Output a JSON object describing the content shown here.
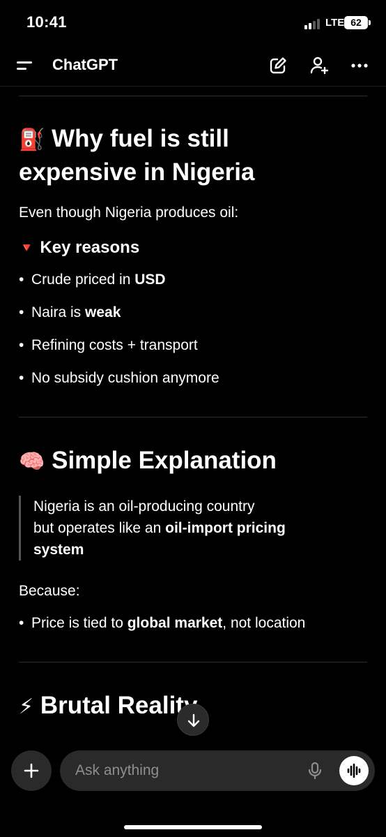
{
  "status_bar": {
    "time": "10:41",
    "network": "LTE",
    "battery": "62"
  },
  "header": {
    "title": "ChatGPT",
    "icons": [
      "menu-icon",
      "new-chat-icon",
      "add-person-icon",
      "more-icon"
    ]
  },
  "sections": [
    {
      "emoji": "⛽",
      "emoji_icon": "fuel-pump-icon",
      "heading_line1": "Why fuel is still",
      "heading_line2": "expensive in Nigeria",
      "intro": "Even though Nigeria produces oil:",
      "subheading_emoji": "🔻",
      "subheading": "Key reasons",
      "bullets": [
        {
          "text": "Crude priced in ",
          "bold": "USD"
        },
        {
          "text": "Naira is ",
          "bold": "weak"
        },
        {
          "text": "Refining costs + transport",
          "bold": ""
        },
        {
          "text": "No subsidy cushion anymore",
          "bold": ""
        }
      ]
    },
    {
      "emoji": "🧠",
      "emoji_icon": "brain-icon",
      "heading": "Simple Explanation",
      "quote_line1": "Nigeria is an oil-producing country",
      "quote_line2_prefix": "but operates like an ",
      "quote_line2_bold": "oil-import pricing",
      "quote_line3_bold": "system",
      "because": "Because:",
      "bullet_prefix": "Price is tied to ",
      "bullet_bold": "global market",
      "bullet_suffix": ", not location"
    },
    {
      "emoji": "⚡",
      "emoji_icon": "lightning-icon",
      "heading": "Brutal Reality"
    }
  ],
  "composer": {
    "placeholder": "Ask anything"
  },
  "colors": {
    "background": "#000000",
    "text": "#ffffff",
    "composer_bg": "#2a2a2a",
    "placeholder": "#8e8e8e",
    "divider": "#2e2e2e"
  }
}
